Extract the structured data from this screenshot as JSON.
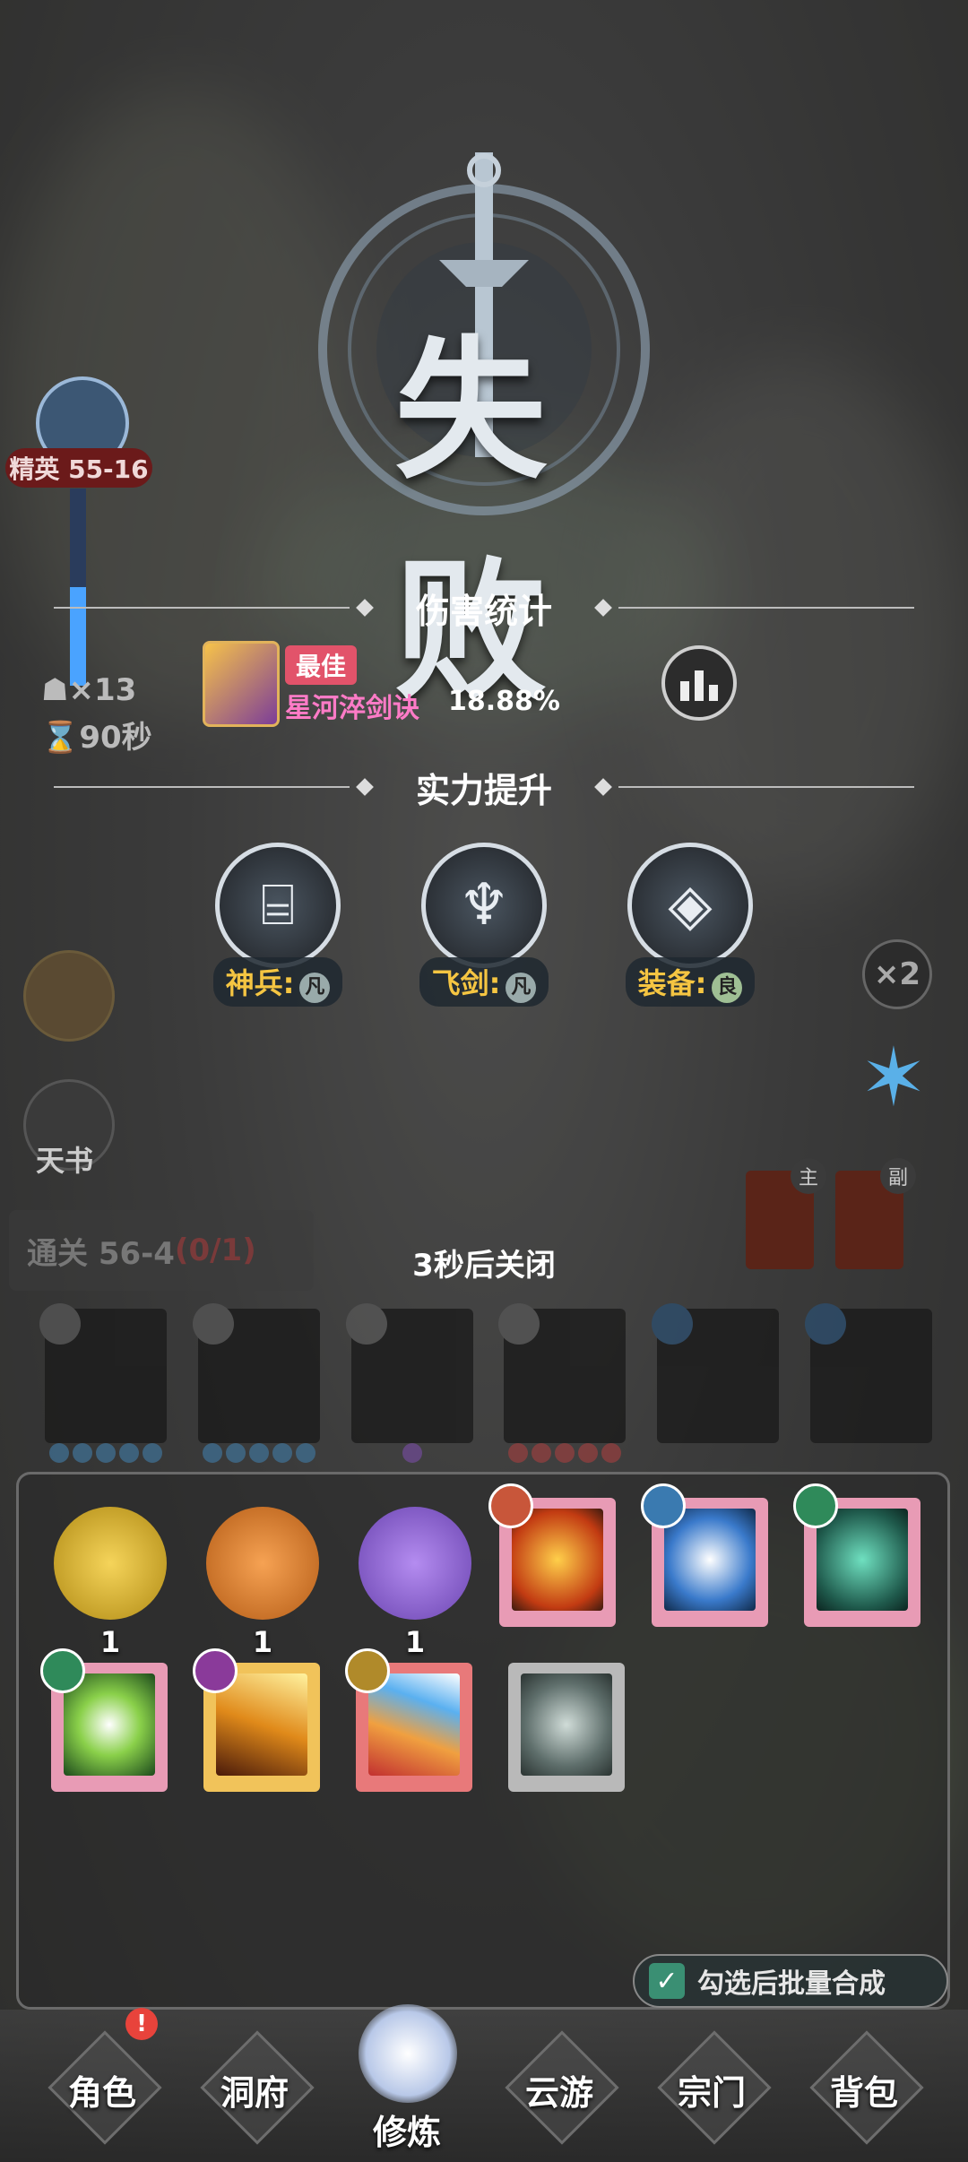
{
  "result": {
    "title": "失败"
  },
  "stage": {
    "badge": "精英 55-16",
    "enemies": "×13",
    "time": "90秒",
    "book_label": "天书"
  },
  "damage": {
    "section": "伤害统计",
    "best_badge": "最佳",
    "skill_name": "星河淬剑诀",
    "percent": "18.88%"
  },
  "power": {
    "section": "实力提升",
    "items": [
      {
        "label": "神兵:",
        "quality": "凡",
        "icon": "cauldron-icon"
      },
      {
        "label": "飞剑:",
        "quality": "凡",
        "icon": "flying-sword-icon"
      },
      {
        "label": "装备:",
        "quality": "良",
        "icon": "equipment-cube-icon"
      }
    ]
  },
  "speed": {
    "label": "×2"
  },
  "quest": {
    "text": "通关 56-4",
    "progress": "(0/1)"
  },
  "weapons": {
    "main": "主",
    "sub": "副"
  },
  "closing": "3秒后关闭",
  "inventory": {
    "orbs": [
      {
        "count": "1",
        "color": "#e0b524"
      },
      {
        "count": "1",
        "color": "#e88a2a"
      },
      {
        "count": "1",
        "color": "#9a6ee0"
      }
    ],
    "merge_label": "勾选后批量合成"
  },
  "nav": [
    {
      "label": "角色"
    },
    {
      "label": "洞府"
    },
    {
      "label": "修炼"
    },
    {
      "label": "云游"
    },
    {
      "label": "宗门"
    },
    {
      "label": "背包"
    }
  ],
  "alert": "!"
}
